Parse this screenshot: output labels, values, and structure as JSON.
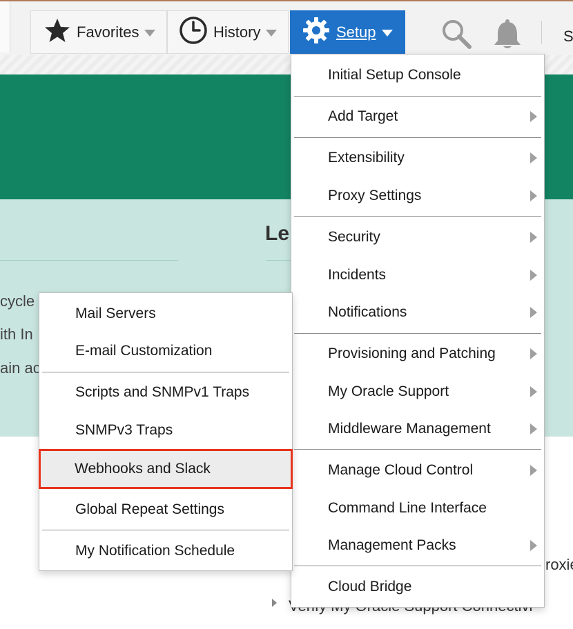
{
  "toolbar": {
    "favorites_label": "Favorites",
    "history_label": "History",
    "setup_label": "Setup",
    "truncated_text": "S",
    "icons": [
      "star-icon",
      "clock-icon",
      "gear-icon",
      "search-icon",
      "bell-icon"
    ],
    "setup_active_color": "#1f72c8"
  },
  "background": {
    "heading_fragment": "Le",
    "left_fragments": [
      "cycle",
      "ith In",
      "ain ac"
    ],
    "lower_fragments": [
      "roxie",
      "Verify My Oracle Support Connectivi"
    ],
    "banner_color": "#138462",
    "panel_color": "#c9e5df"
  },
  "setup_menu": {
    "items": [
      {
        "label": "Initial Setup Console",
        "has_submenu": false
      },
      {
        "label": "Add Target",
        "has_submenu": true
      },
      {
        "label": "Extensibility",
        "has_submenu": true
      },
      {
        "label": "Proxy Settings",
        "has_submenu": true
      },
      {
        "label": "Security",
        "has_submenu": true
      },
      {
        "label": "Incidents",
        "has_submenu": true
      },
      {
        "label": "Notifications",
        "has_submenu": true
      },
      {
        "label": "Provisioning and Patching",
        "has_submenu": true
      },
      {
        "label": "My Oracle Support",
        "has_submenu": true
      },
      {
        "label": "Middleware Management",
        "has_submenu": true
      },
      {
        "label": "Manage Cloud Control",
        "has_submenu": true
      },
      {
        "label": "Command Line Interface",
        "has_submenu": false
      },
      {
        "label": "Management Packs",
        "has_submenu": true
      },
      {
        "label": "Cloud Bridge",
        "has_submenu": false
      }
    ]
  },
  "notifications_menu": {
    "items": [
      {
        "label": "Mail Servers"
      },
      {
        "label": "E-mail Customization"
      },
      {
        "label": "Scripts and SNMPv1 Traps"
      },
      {
        "label": "SNMPv3 Traps"
      },
      {
        "label": "Webhooks and Slack"
      },
      {
        "label": "Global Repeat Settings"
      },
      {
        "label": "My Notification Schedule"
      }
    ],
    "highlight_color": "#e8341c"
  }
}
